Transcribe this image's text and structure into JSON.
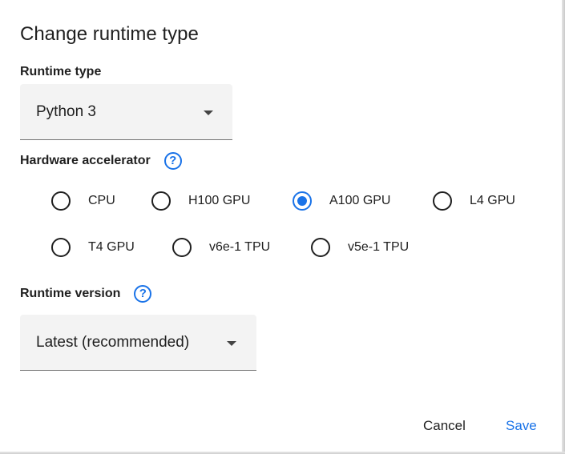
{
  "dialog": {
    "title": "Change runtime type",
    "runtime_type": {
      "label": "Runtime type",
      "value": "Python 3"
    },
    "hardware_accelerator": {
      "label": "Hardware accelerator",
      "help_glyph": "?",
      "options": [
        {
          "label": "CPU",
          "checked": false
        },
        {
          "label": "H100 GPU",
          "checked": false
        },
        {
          "label": "A100 GPU",
          "checked": true
        },
        {
          "label": "L4 GPU",
          "checked": false
        },
        {
          "label": "T4 GPU",
          "checked": false
        },
        {
          "label": "v6e-1 TPU",
          "checked": false
        },
        {
          "label": "v5e-1 TPU",
          "checked": false
        }
      ]
    },
    "runtime_version": {
      "label": "Runtime version",
      "help_glyph": "?",
      "value": "Latest (recommended)"
    },
    "buttons": {
      "cancel": "Cancel",
      "save": "Save"
    },
    "colors": {
      "accent": "#1a73e8",
      "top_bar": "#f4a949",
      "select_bg": "#f3f3f3"
    }
  }
}
